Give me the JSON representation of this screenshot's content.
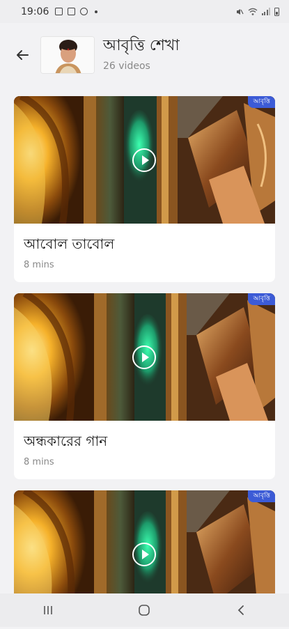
{
  "status_bar": {
    "time": "19:06"
  },
  "header": {
    "title": "আবৃত্তি শেখা",
    "subtitle": "26 videos"
  },
  "videos": [
    {
      "title": "আবোল তাবোল",
      "duration": "8 mins",
      "badge": "আবৃত্তি"
    },
    {
      "title": "অন্ধকারের গান",
      "duration": "8 mins",
      "badge": "আবৃত্তি"
    },
    {
      "title": "",
      "duration": "",
      "badge": "আবৃত্তি"
    }
  ],
  "colors": {
    "badge": "#3c5bd6",
    "background": "#f2f2f4"
  }
}
